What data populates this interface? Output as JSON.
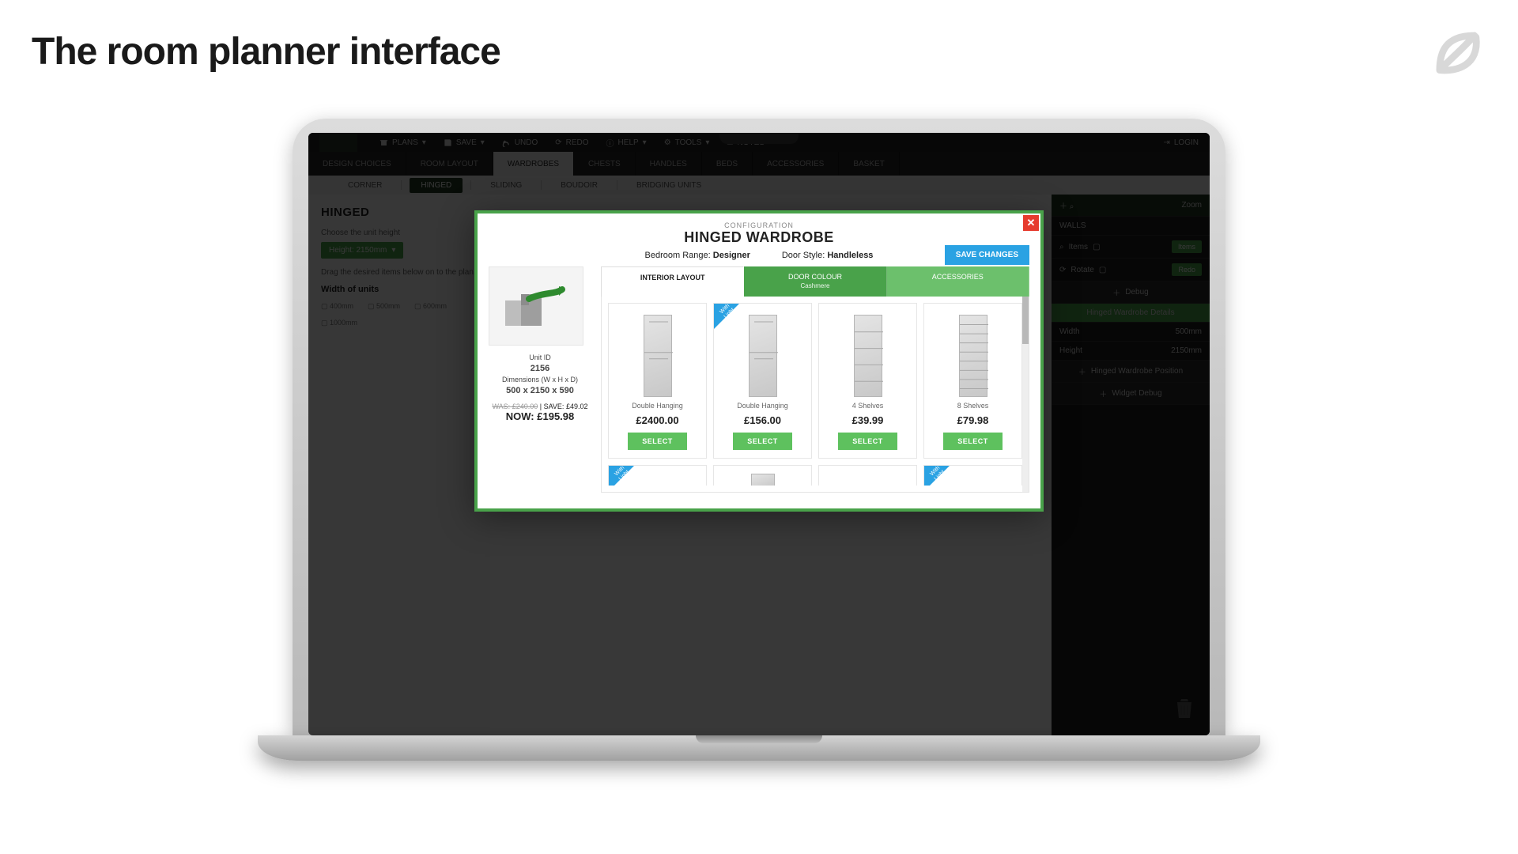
{
  "slide": {
    "title": "The room planner interface"
  },
  "menubar": {
    "items": [
      "PLANS",
      "SAVE",
      "UNDO",
      "REDO",
      "HELP",
      "TOOLS",
      "NOTES"
    ],
    "login": "LOGIN"
  },
  "maintabs": [
    "DESIGN CHOICES",
    "ROOM LAYOUT",
    "WARDROBES",
    "CHESTS",
    "HANDLES",
    "BEDS",
    "ACCESSORIES",
    "BASKET"
  ],
  "maintabs_active": "WARDROBES",
  "subtabs": [
    "CORNER",
    "HINGED",
    "SLIDING",
    "BOUDOIR",
    "BRIDGING UNITS"
  ],
  "subtabs_active": "HINGED",
  "left": {
    "title": "HINGED",
    "choose_label": "Choose the unit height",
    "height_value": "Height: 2150mm",
    "drag_hint": "Drag the desired items below on to the plan.",
    "width_label": "Width of units"
  },
  "right": {
    "zoom": "Zoom",
    "walls": "WALLS",
    "items_label": "Items",
    "items_btn": "Items",
    "rotate_label": "Rotate",
    "rotate_btn": "Redo",
    "debug": "Debug",
    "details_header": "Hinged Wardrobe Details",
    "width_label": "Width",
    "width_value": "500mm",
    "height_label": "Height",
    "height_value": "2150mm",
    "pos_header": "Hinged Wardrobe Position",
    "widget_header": "Widget Debug"
  },
  "modal": {
    "overline": "CONFIGURATION",
    "title": "HINGED WARDROBE",
    "range_label": "Bedroom Range:",
    "range_value": "Designer",
    "doorstyle_label": "Door Style:",
    "doorstyle_value": "Handleless",
    "save_btn": "SAVE CHANGES",
    "unit": {
      "id_label": "Unit ID",
      "id": "2156",
      "dims_label": "Dimensions (W x H x D)",
      "dims": "500 x 2150 x 590",
      "was_label": "WAS:",
      "was": "£240.00",
      "save_label": "SAVE:",
      "save": "£49.02",
      "now_label": "NOW:",
      "now": "£195.98"
    },
    "cfg_tabs": {
      "layout": "INTERIOR LAYOUT",
      "door_colour": "DOOR COLOUR",
      "door_colour_sub": "Cashmere",
      "accessories": "ACCESSORIES"
    },
    "products": [
      {
        "name": "Double Hanging",
        "price": "£2400.00",
        "badge": false,
        "shelves": 0
      },
      {
        "name": "Double Hanging",
        "price": "£156.00",
        "badge": "With Light",
        "shelves": 0
      },
      {
        "name": "4 Shelves",
        "price": "£39.99",
        "badge": false,
        "shelves": 4
      },
      {
        "name": "8 Shelves",
        "price": "£79.98",
        "badge": false,
        "shelves": 8
      }
    ],
    "select_label": "SELECT",
    "row2_badges": [
      "With Light",
      "With Light"
    ]
  }
}
